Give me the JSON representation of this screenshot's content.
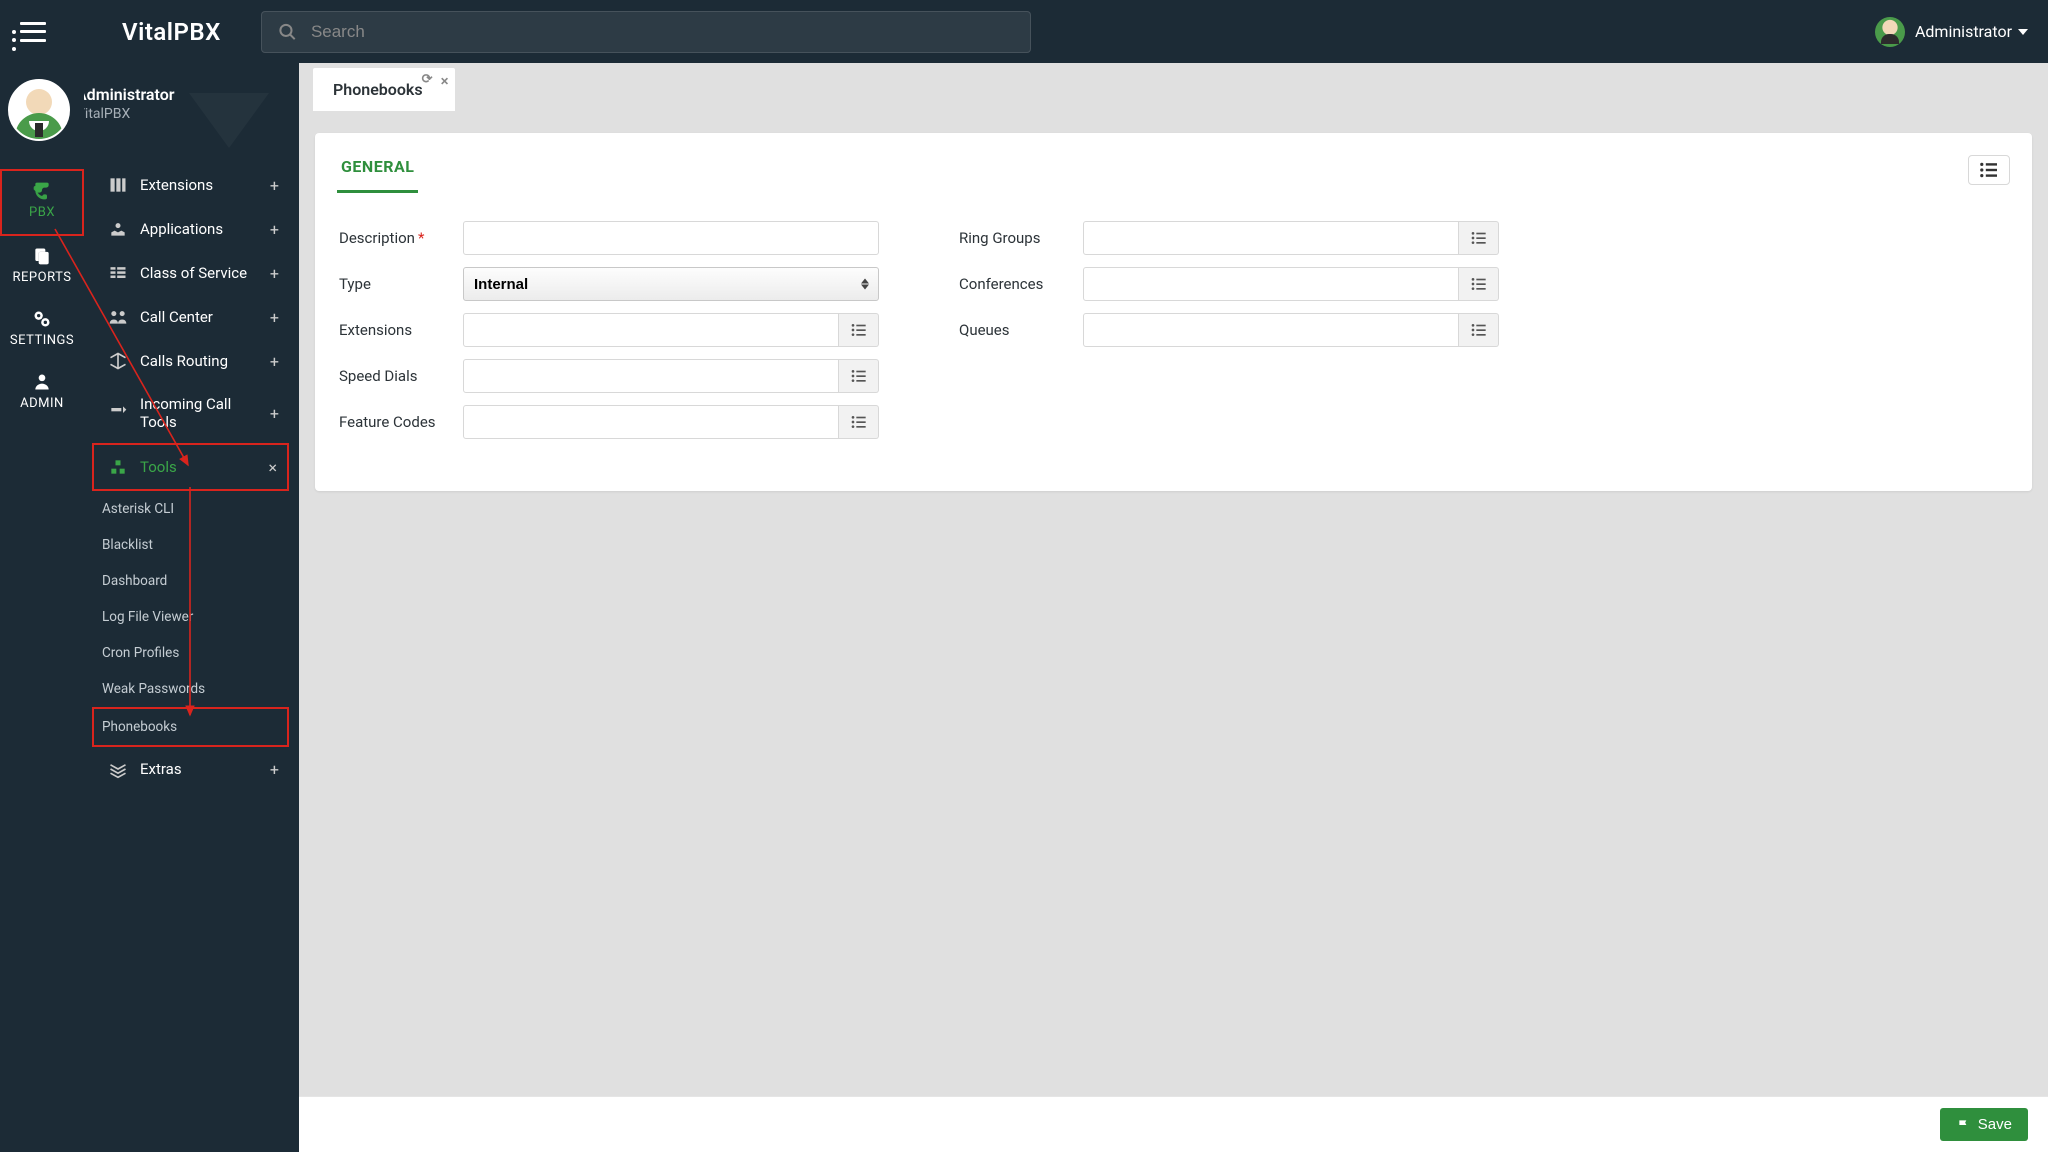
{
  "topbar": {
    "brand": "VitalPBX",
    "search_placeholder": "Search",
    "user": "Administrator"
  },
  "sidebar_user": {
    "name": "Administrator",
    "company": "VitalPBX"
  },
  "narrow_nav": [
    {
      "id": "pbx",
      "label": "PBX",
      "active": true
    },
    {
      "id": "reports",
      "label": "REPORTS",
      "active": false
    },
    {
      "id": "settings",
      "label": "SETTINGS",
      "active": false
    },
    {
      "id": "admin",
      "label": "ADMIN",
      "active": false
    }
  ],
  "wide_nav": {
    "items": [
      {
        "label": "Extensions",
        "expanded": false
      },
      {
        "label": "Applications",
        "expanded": false
      },
      {
        "label": "Class of Service",
        "expanded": false
      },
      {
        "label": "Call Center",
        "expanded": false
      },
      {
        "label": "Calls Routing",
        "expanded": false
      },
      {
        "label": "Incoming Call Tools",
        "expanded": false
      },
      {
        "label": "Tools",
        "expanded": true
      },
      {
        "label": "Extras",
        "expanded": false
      }
    ],
    "tools_sub": [
      "Asterisk CLI",
      "Blacklist",
      "Dashboard",
      "Log File Viewer",
      "Cron Profiles",
      "Weak Passwords",
      "Phonebooks"
    ]
  },
  "tabs": {
    "active": "Phonebooks"
  },
  "panel": {
    "tab": "GENERAL",
    "fields_left": {
      "description": "Description",
      "type_label": "Type",
      "type_value": "Internal",
      "extensions": "Extensions",
      "speed_dials": "Speed Dials",
      "feature_codes": "Feature Codes"
    },
    "fields_right": {
      "ring_groups": "Ring Groups",
      "conferences": "Conferences",
      "queues": "Queues"
    }
  },
  "footer": {
    "save": "Save"
  }
}
